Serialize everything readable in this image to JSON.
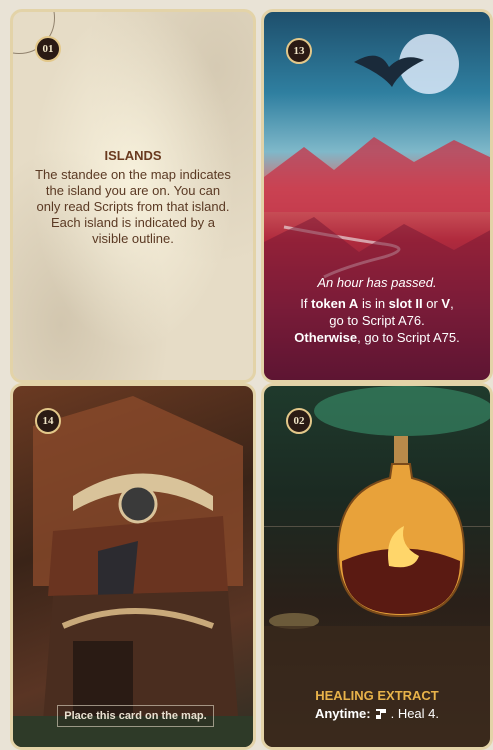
{
  "cards": [
    {
      "number": "01",
      "title": "ISLANDS",
      "body": "The standee on the map indicates the island you are on. You can only read Scripts from that island. Each island is indicated by a visible outline."
    },
    {
      "number": "13",
      "italic": "An hour has passed.",
      "line1_prefix": "If ",
      "line1_token": "token A",
      "line1_mid": " is in ",
      "line1_slot": "slot II",
      "line1_or": " or ",
      "line1_v": "V",
      "line1_end": ",",
      "line2": "go to Script A76.",
      "line3_bold": "Otherwise",
      "line3_rest": ", go to Script A75."
    },
    {
      "number": "14",
      "note": "Place this card on the map."
    },
    {
      "number": "02",
      "title": "HEALING EXTRACT",
      "body_bold": "Anytime:",
      "body_rest": ". Heal 4.",
      "icon": "scroll-icon"
    }
  ]
}
